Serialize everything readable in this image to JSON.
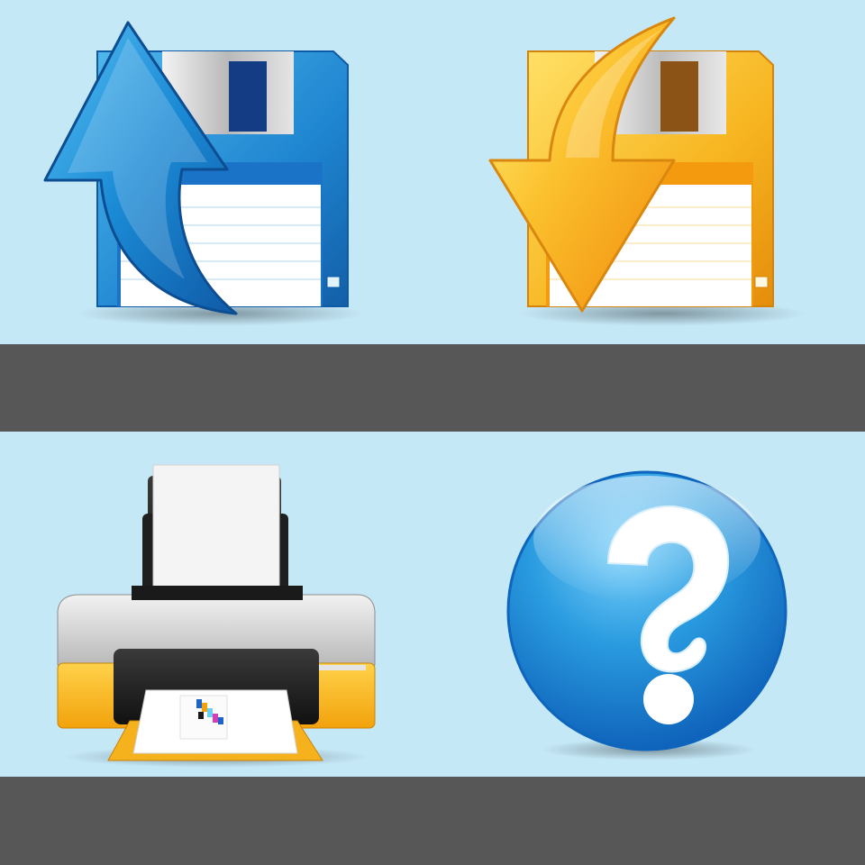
{
  "colors": {
    "background": "#c5e8f7",
    "band": "#575757"
  },
  "icons": [
    {
      "name": "floppy-disk-upload-icon"
    },
    {
      "name": "floppy-disk-download-icon"
    },
    {
      "name": "printer-icon"
    },
    {
      "name": "help-question-icon"
    }
  ]
}
